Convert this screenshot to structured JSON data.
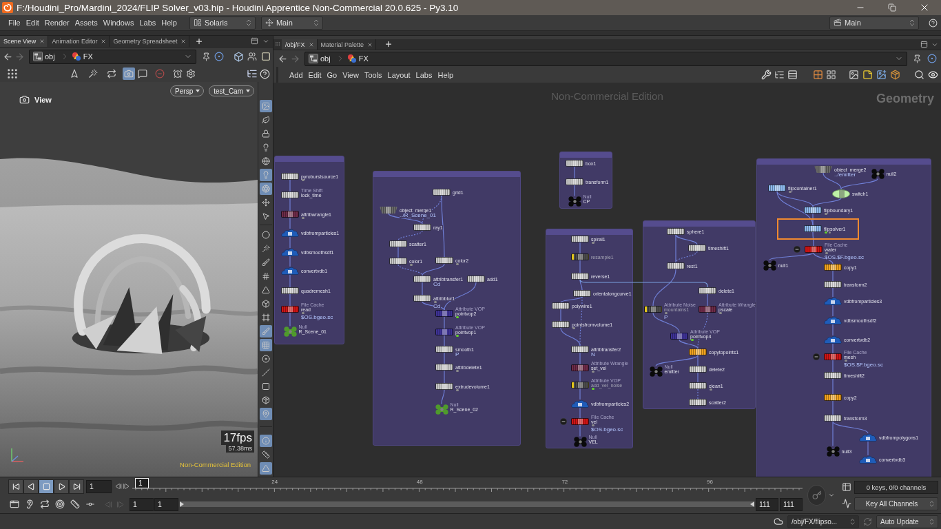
{
  "window": {
    "title": "F:/Houdini_Pro/Mardini_2024/FLIP Solver_v03.hip - Houdini Apprentice Non-Commercial 20.0.625 - Py3.10"
  },
  "menu_bar": {
    "items": [
      "File",
      "Edit",
      "Render",
      "Assets",
      "Windows",
      "Labs",
      "Help"
    ],
    "desktop": "Solaris",
    "shelf_set": "Main",
    "run_set": "Main"
  },
  "left_pane": {
    "tabs": [
      {
        "label": "Scene View",
        "selected": true
      },
      {
        "label": "Animation Editor",
        "selected": false
      },
      {
        "label": "Geometry Spreadsheet",
        "selected": false
      }
    ],
    "path": [
      "obj",
      "FX"
    ],
    "view_tools": [
      {
        "selected": false
      },
      {
        "selected": false
      },
      {
        "selected": false
      },
      {
        "selected": true
      },
      {
        "selected": false
      },
      {
        "selected": false
      },
      {
        "selected": false
      },
      {
        "selected": false
      }
    ],
    "viewport": {
      "view_label": "View",
      "camera_menus": [
        "Persp",
        "test_Cam"
      ],
      "fps": "17fps",
      "frame_time": "57.38ms",
      "edition": "Non-Commercial Edition"
    },
    "side_tools": [
      {
        "selected": true
      },
      {
        "selected": false
      },
      {
        "selected": false
      },
      {
        "selected": false
      },
      {
        "selected": false
      },
      {
        "selected": true
      },
      {
        "selected": true
      },
      {
        "selected": false
      },
      {
        "selected": false
      },
      {
        "selected": false
      },
      {
        "selected": false
      },
      {
        "selected": false
      },
      {
        "selected": false
      },
      {
        "selected": false
      },
      {
        "selected": false
      },
      {
        "selected": false
      },
      {
        "selected": true
      },
      {
        "selected": true
      },
      {
        "selected": false
      },
      {
        "selected": false
      },
      {
        "selected": false
      },
      {
        "selected": false
      },
      {
        "selected": true
      },
      {
        "selected": true
      },
      {
        "selected": false
      },
      {
        "selected": true
      }
    ]
  },
  "right_pane": {
    "tabs": [
      {
        "label": "/obj/FX",
        "selected": true
      },
      {
        "label": "Material Palette",
        "selected": false
      }
    ],
    "path": [
      "obj",
      "FX"
    ],
    "menu": [
      "Add",
      "Edit",
      "Go",
      "View",
      "Tools",
      "Layout",
      "Labs",
      "Help"
    ],
    "network": {
      "watermark": "Non-Commercial Edition",
      "context": "Geometry",
      "boxes": [
        {
          "nodes": [
            {
              "name": "pyroburstsource1",
              "kind": "sop",
              "color": "#c8c8c8",
              "dots": [
                {
                  "color": "#8c8c8c"
                }
              ],
              "bypassed": false,
              "selected": false,
              "badge": false
            },
            {
              "name": "lock_time",
              "type_label": "Time Shift",
              "kind": "sop",
              "color": "#c8c8c8",
              "bypassed": false,
              "selected": false,
              "badge": false
            },
            {
              "name": "attribwrangle1",
              "kind": "sop",
              "color": "#6e2b48",
              "dots": [
                {
                  "color": "#8c8c8c"
                }
              ],
              "bypassed": false,
              "selected": false,
              "badge": false
            },
            {
              "name": "vdbfromparticles1",
              "kind": "vdb",
              "color": "#1f5cb8",
              "bypassed": false,
              "selected": false,
              "badge": false
            },
            {
              "name": "vdbsmoothsdf1",
              "kind": "vdb",
              "color": "#1f5cb8",
              "bypassed": false,
              "selected": false,
              "badge": false
            },
            {
              "name": "convertvdb1",
              "kind": "vdb",
              "color": "#1f5cb8",
              "bypassed": false,
              "selected": false,
              "badge": false
            },
            {
              "name": "quadremesh1",
              "kind": "sop",
              "color": "#c8c8c8",
              "bypassed": false,
              "selected": false,
              "badge": false
            },
            {
              "name": "read",
              "type_label": "File Cache",
              "param": "$OS.bgeo.sc",
              "kind": "sop",
              "color": "#d01414",
              "dots": [
                {
                  "color": "#8c8c8c"
                }
              ],
              "bypassed": false,
              "selected": false,
              "badge": false
            },
            {
              "name": "R_Scene_01",
              "type_label": "Null",
              "kind": "null",
              "color": "#4f9a2c",
              "bypassed": false,
              "selected": false,
              "badge": false
            }
          ]
        },
        {
          "nodes": [
            {
              "name": "grid1",
              "kind": "sop",
              "color": "#c8c8c8",
              "bypassed": false,
              "selected": false,
              "badge": false
            },
            {
              "name": "object_merge1",
              "param": "../R_Scene_01",
              "kind": "merge",
              "color": "#6a6a6a",
              "bypassed": false,
              "selected": false,
              "badge": false
            },
            {
              "name": "ray1",
              "kind": "sop",
              "color": "#c8c8c8",
              "bypassed": false,
              "selected": false,
              "badge": false
            },
            {
              "name": "scatter1",
              "kind": "sop",
              "color": "#c8c8c8",
              "bypassed": false,
              "selected": false,
              "badge": false
            },
            {
              "name": "color1",
              "kind": "sop",
              "color": "#c8c8c8",
              "dots": [
                {
                  "color": "#8c8c8c"
                }
              ],
              "bypassed": false,
              "selected": false,
              "badge": false
            },
            {
              "name": "color2",
              "kind": "sop",
              "color": "#c8c8c8",
              "dots": [
                {
                  "color": "#8c8c8c"
                }
              ],
              "bypassed": false,
              "selected": false,
              "badge": false
            },
            {
              "name": "attribtransfer1",
              "param": "Cd",
              "kind": "sop",
              "color": "#c8c8c8",
              "bypassed": false,
              "selected": false,
              "badge": false
            },
            {
              "name": "add1",
              "kind": "sop",
              "color": "#c8c8c8",
              "bypassed": false,
              "selected": false,
              "badge": false
            },
            {
              "name": "attribblur1",
              "param": "Cd",
              "kind": "sop",
              "color": "#c8c8c8",
              "dots": [
                {
                  "color": "#8c8c8c"
                }
              ],
              "bypassed": false,
              "selected": false,
              "badge": false
            },
            {
              "name": "pointvop2",
              "type_label": "Attribute VOP",
              "kind": "sop",
              "color": "#3e3296",
              "dots": [
                {
                  "color": "#63d22b"
                }
              ],
              "bypassed": false,
              "selected": false,
              "badge": false
            },
            {
              "name": "pointvop1",
              "type_label": "Attribute VOP",
              "kind": "sop",
              "color": "#3e3296",
              "dots": [
                {
                  "color": "#63d22b"
                }
              ],
              "bypassed": false,
              "selected": false,
              "badge": false
            },
            {
              "name": "smooth1",
              "param": "P",
              "kind": "sop",
              "color": "#c8c8c8",
              "bypassed": false,
              "selected": false,
              "badge": false
            },
            {
              "name": "attribdelete1",
              "kind": "sop",
              "color": "#c8c8c8",
              "dots": [
                {
                  "color": "#8c8c8c"
                }
              ],
              "bypassed": false,
              "selected": false,
              "badge": false
            },
            {
              "name": "extrudevolume1",
              "kind": "sop",
              "color": "#c8c8c8",
              "dots": [
                {
                  "color": "#8c8c8c"
                }
              ],
              "bypassed": false,
              "selected": false,
              "badge": false
            },
            {
              "name": "R_Scene_02",
              "type_label": "Null",
              "kind": "null",
              "color": "#4f9a2c",
              "bypassed": false,
              "selected": false,
              "badge": false
            }
          ]
        },
        {
          "nodes": [
            {
              "name": "box1",
              "kind": "sop",
              "color": "#c8c8c8",
              "bypassed": false,
              "selected": false,
              "badge": false
            },
            {
              "name": "transform1",
              "kind": "sop",
              "color": "#c8c8c8",
              "bypassed": false,
              "selected": false,
              "badge": false
            },
            {
              "name": "CP",
              "type_label": "Null",
              "kind": "null",
              "color": "#0a0a0a",
              "bypassed": false,
              "selected": false,
              "badge": false
            }
          ]
        },
        {
          "nodes": [
            {
              "name": "spiral1",
              "kind": "sop",
              "color": "#c8c8c8",
              "dots": [
                {
                  "color": "#8c8c8c"
                }
              ],
              "bypassed": false,
              "selected": false,
              "badge": false
            },
            {
              "name": "resample1",
              "kind": "sop",
              "color": "#4c4c4c",
              "bypassed": true,
              "selected": false,
              "badge": false
            },
            {
              "name": "reverse1",
              "kind": "sop",
              "color": "#c8c8c8",
              "bypassed": false,
              "selected": false,
              "badge": false
            },
            {
              "name": "orientalongcurve1",
              "kind": "sop",
              "color": "#c8c8c8",
              "bypassed": false,
              "selected": false,
              "badge": false
            },
            {
              "name": "polywire1",
              "kind": "sop",
              "color": "#c8c8c8",
              "bypassed": false,
              "selected": false,
              "badge": false
            },
            {
              "name": "pointsfromvolume1",
              "kind": "sop",
              "color": "#c8c8c8",
              "dots": [
                {
                  "color": "#8c8c8c"
                }
              ],
              "bypassed": false,
              "selected": false,
              "badge": false
            },
            {
              "name": "attribtransfer2",
              "param": "N",
              "kind": "sop",
              "color": "#c8c8c8",
              "bypassed": false,
              "selected": false,
              "badge": false
            },
            {
              "name": "set_vel",
              "type_label": "Attribute Wrangle",
              "kind": "sop",
              "color": "#6e2b48",
              "dots": [
                {
                  "color": "#8c8c8c"
                }
              ],
              "bypassed": false,
              "selected": false,
              "badge": false
            },
            {
              "name": "add_vel_noise",
              "type_label": "Attribute VOP",
              "kind": "sop",
              "color": "#4c4c4c",
              "dots": [
                {
                  "color": "#63d22b"
                }
              ],
              "bypassed": true,
              "selected": false,
              "badge": false
            },
            {
              "name": "vdbfromparticles2",
              "kind": "vdb",
              "color": "#1f5cb8",
              "bypassed": false,
              "selected": false,
              "badge": false
            },
            {
              "name": "vel",
              "type_label": "File Cache",
              "param": "$OS.bgeo.sc",
              "kind": "sop",
              "color": "#d01414",
              "dots": [
                {
                  "color": "#8c8c8c"
                }
              ],
              "bypassed": false,
              "selected": false,
              "badge": true
            },
            {
              "name": "VEL",
              "type_label": "Null",
              "kind": "null",
              "color": "#0a0a0a",
              "bypassed": false,
              "selected": false,
              "badge": false
            }
          ]
        },
        {
          "nodes": [
            {
              "name": "sphere1",
              "kind": "sop",
              "color": "#c8c8c8",
              "bypassed": false,
              "selected": false,
              "badge": false
            },
            {
              "name": "timeshift1",
              "kind": "sop",
              "color": "#c8c8c8",
              "bypassed": false,
              "selected": false,
              "badge": false
            },
            {
              "name": "rest1",
              "kind": "sop",
              "color": "#c8c8c8",
              "bypassed": false,
              "selected": false,
              "badge": false
            },
            {
              "name": "delete1",
              "kind": "sop",
              "color": "#c8c8c8",
              "bypassed": false,
              "selected": false,
              "badge": false
            },
            {
              "name": "mountains1",
              "type_label": "Attribute Noise",
              "param": "P",
              "kind": "sop",
              "color": "#4c4c4c",
              "dots": [
                {
                  "color": "#8c8c8c"
                }
              ],
              "bypassed": true,
              "selected": false,
              "badge": false
            },
            {
              "name": "pscale",
              "type_label": "Attribute Wrangle",
              "kind": "sop",
              "color": "#6e2b48",
              "dots": [
                {
                  "color": "#8c8c8c"
                }
              ],
              "bypassed": false,
              "selected": false,
              "badge": false
            },
            {
              "name": "pointvop4",
              "type_label": "Attribute VOP",
              "kind": "sop",
              "color": "#3e3296",
              "dots": [
                {
                  "color": "#63d22b"
                }
              ],
              "bypassed": false,
              "selected": false,
              "badge": false
            },
            {
              "name": "copytopoints1",
              "kind": "sop",
              "color": "#f0a21e",
              "bypassed": false,
              "selected": false,
              "badge": false
            },
            {
              "name": "emitter",
              "type_label": "Null",
              "kind": "null",
              "color": "#0a0a0a",
              "bypassed": false,
              "selected": false,
              "badge": false
            },
            {
              "name": "delete2",
              "kind": "sop",
              "color": "#c8c8c8",
              "bypassed": false,
              "selected": false,
              "badge": false
            },
            {
              "name": "clean1",
              "kind": "sop",
              "color": "#c8c8c8",
              "dots": [
                {
                  "color": "#8c8c8c"
                }
              ],
              "bypassed": false,
              "selected": false,
              "badge": false
            },
            {
              "name": "scatter2",
              "kind": "sop",
              "color": "#c8c8c8",
              "bypassed": false,
              "selected": false,
              "badge": false
            }
          ]
        },
        {
          "nodes": [
            {
              "name": "object_merge2",
              "param": "../emitter",
              "kind": "merge",
              "color": "#6a6a6a",
              "bypassed": false,
              "selected": false,
              "badge": false
            },
            {
              "name": "null2",
              "kind": "null",
              "color": "#0a0a0a",
              "bypassed": false,
              "selected": false,
              "badge": false
            },
            {
              "name": "flipcontainer1",
              "kind": "sop",
              "color": "#8db9ee",
              "dots": [
                {
                  "color": "#8c8c8c"
                }
              ],
              "bypassed": false,
              "selected": false,
              "badge": false
            },
            {
              "name": "switch1",
              "kind": "switch",
              "color": "#bdf0a6",
              "bypassed": false,
              "selected": false,
              "badge": false
            },
            {
              "name": "flipboundary1",
              "kind": "sop",
              "color": "#8db9ee",
              "dots": [
                {
                  "color": "#8c8c8c"
                }
              ],
              "bypassed": false,
              "selected": false,
              "badge": false
            },
            {
              "name": "flipsolver1",
              "kind": "sop",
              "color": "#8db9ee",
              "dots": [
                {
                  "color": "#63d22b"
                },
                {
                  "color": "#8c8c8c"
                }
              ],
              "bypassed": false,
              "selected": true,
              "badge": false
            },
            {
              "name": "water",
              "type_label": "File Cache",
              "param": "$OS.$F.bgeo.sc",
              "kind": "sop",
              "color": "#d01414",
              "dots": [
                {
                  "color": "#8c8c8c"
                }
              ],
              "bypassed": false,
              "selected": false,
              "badge": true
            },
            {
              "name": "null1",
              "kind": "null",
              "color": "#0a0a0a",
              "bypassed": false,
              "selected": false,
              "badge": false
            },
            {
              "name": "copy1",
              "kind": "sop",
              "color": "#f0a21e",
              "bypassed": false,
              "selected": false,
              "badge": false
            },
            {
              "name": "transform2",
              "kind": "sop",
              "color": "#c8c8c8",
              "bypassed": false,
              "selected": false,
              "badge": false
            },
            {
              "name": "vdbfromparticles3",
              "kind": "vdb",
              "color": "#1f5cb8",
              "bypassed": false,
              "selected": false,
              "badge": false
            },
            {
              "name": "vdbsmoothsdf2",
              "kind": "vdb",
              "color": "#1f5cb8",
              "bypassed": false,
              "selected": false,
              "badge": false
            },
            {
              "name": "convertvdb2",
              "kind": "vdb",
              "color": "#1f5cb8",
              "bypassed": false,
              "selected": false,
              "badge": false
            },
            {
              "name": "mesh",
              "type_label": "File Cache",
              "param": "$OS.$F.bgeo.sc",
              "kind": "sop",
              "color": "#d01414",
              "dots": [
                {
                  "color": "#8c8c8c"
                }
              ],
              "bypassed": false,
              "selected": false,
              "badge": true
            },
            {
              "name": "timeshift2",
              "kind": "sop",
              "color": "#c8c8c8",
              "bypassed": false,
              "selected": false,
              "badge": false
            },
            {
              "name": "copy2",
              "kind": "sop",
              "color": "#f0a21e",
              "bypassed": false,
              "selected": false,
              "badge": false
            },
            {
              "name": "transform3",
              "kind": "sop",
              "color": "#c8c8c8",
              "bypassed": false,
              "selected": false,
              "badge": false
            },
            {
              "name": "vdbfrompolygons1",
              "kind": "vdb",
              "color": "#1f5cb8",
              "bypassed": false,
              "selected": false,
              "badge": false
            },
            {
              "name": "null3",
              "kind": "null",
              "color": "#0a0a0a",
              "bypassed": false,
              "selected": false,
              "badge": false
            },
            {
              "name": "convertvdb3",
              "kind": "vdb",
              "color": "#1f5cb8",
              "bypassed": false,
              "selected": false,
              "badge": false
            }
          ]
        }
      ]
    }
  },
  "timeline": {
    "transport": [
      {
        "selected": false
      },
      {
        "selected": false
      },
      {
        "selected": true
      },
      {
        "selected": false
      },
      {
        "selected": false
      }
    ],
    "frame_field": "1",
    "marker": "1",
    "ticks": [
      "24",
      "48",
      "72",
      "96"
    ],
    "start_frame": "1",
    "playback_start": "1",
    "playback_end": "111",
    "end_frame": "111",
    "keys_info": "0 keys, 0/0 channels",
    "key_mode": "Key All Channels"
  },
  "status_bar": {
    "path": "/obj/FX/flipso...",
    "update_mode": "Auto Update"
  }
}
